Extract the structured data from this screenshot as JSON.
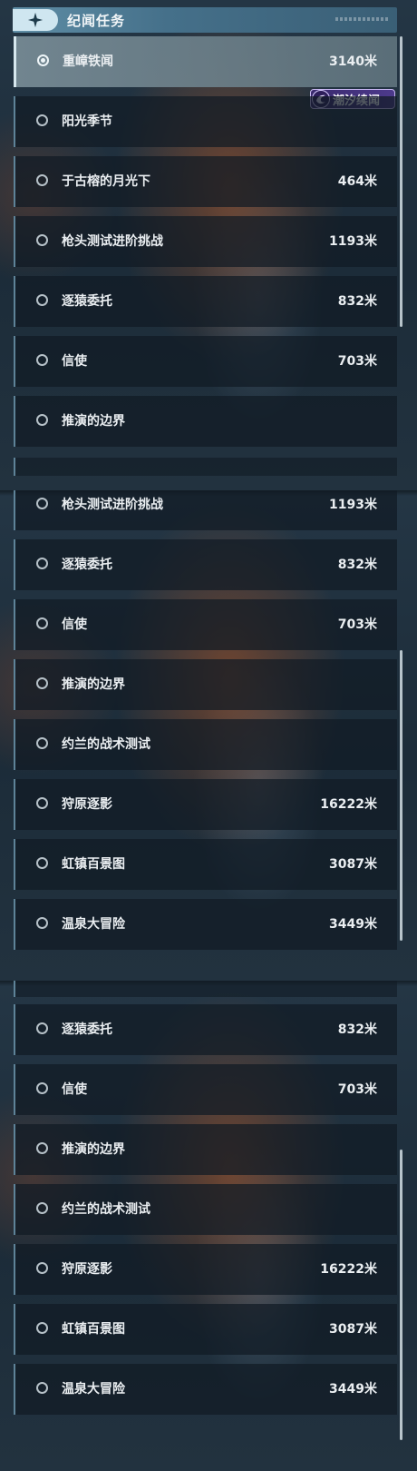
{
  "header": {
    "title": "纪闻任务",
    "icon": "sparkle-icon"
  },
  "tag": {
    "label": "潮汐续闻",
    "icon": "swirl-icon",
    "color": "#4d3a8c"
  },
  "panel1": [
    {
      "label": "重嶂铁闻",
      "distance": "3140米",
      "selected": true
    },
    {
      "label": "阳光季节",
      "distance": ""
    },
    {
      "label": "于古榕的月光下",
      "distance": "464米"
    },
    {
      "label": "枪头测试进阶挑战",
      "distance": "1193米"
    },
    {
      "label": "逐猿委托",
      "distance": "832米"
    },
    {
      "label": "信使",
      "distance": "703米"
    },
    {
      "label": "推演的边界",
      "distance": ""
    }
  ],
  "panel2": [
    {
      "label": "枪头测试进阶挑战",
      "distance": "1193米"
    },
    {
      "label": "逐猿委托",
      "distance": "832米"
    },
    {
      "label": "信使",
      "distance": "703米"
    },
    {
      "label": "推演的边界",
      "distance": ""
    },
    {
      "label": "约兰的战术测试",
      "distance": ""
    },
    {
      "label": "狩原逐影",
      "distance": "16222米"
    },
    {
      "label": "虹镇百景图",
      "distance": "3087米"
    },
    {
      "label": "温泉大冒险",
      "distance": "3449米"
    }
  ],
  "panel3": [
    {
      "label": "逐猿委托",
      "distance": "832米"
    },
    {
      "label": "信使",
      "distance": "703米"
    },
    {
      "label": "推演的边界",
      "distance": ""
    },
    {
      "label": "约兰的战术测试",
      "distance": ""
    },
    {
      "label": "狩原逐影",
      "distance": "16222米"
    },
    {
      "label": "虹镇百景图",
      "distance": "3087米"
    },
    {
      "label": "温泉大冒险",
      "distance": "3449米"
    }
  ]
}
